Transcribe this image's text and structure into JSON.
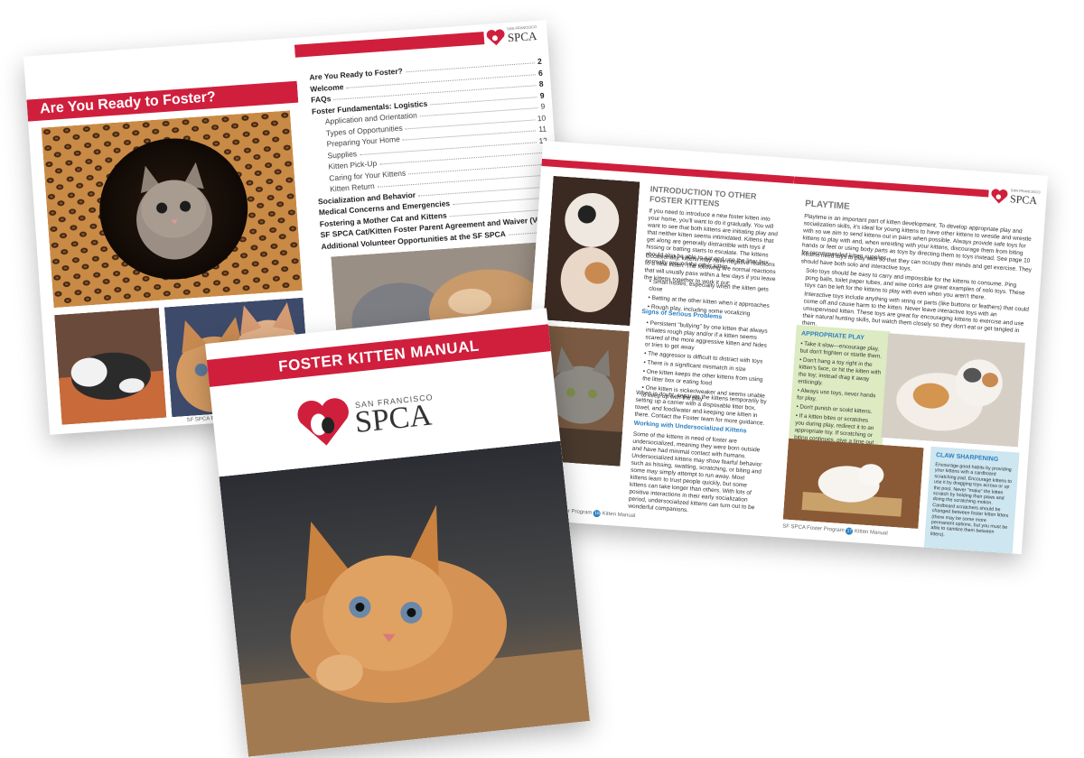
{
  "brand": {
    "small": "SAN FRANCISCO",
    "name": "SPCA",
    "accent": "#cf1f3d"
  },
  "back_spread": {
    "banner": "Are You Ready to Foster?",
    "footer": "SF SPCA Foster Program",
    "toc": [
      {
        "label": "Are You Ready to Foster?",
        "page": "2",
        "style": "b"
      },
      {
        "label": "Welcome",
        "page": "6",
        "style": "b"
      },
      {
        "label": "FAQs",
        "page": "8",
        "style": "b"
      },
      {
        "label": "Foster Fundamentals: Logistics",
        "page": "9",
        "style": "b"
      },
      {
        "label": "Application and Orientation",
        "page": "9",
        "style": "sub"
      },
      {
        "label": "Types of Opportunities",
        "page": "10",
        "style": "sub"
      },
      {
        "label": "Preparing Your Home",
        "page": "11",
        "style": "sub"
      },
      {
        "label": "Supplies",
        "page": "12",
        "style": "sub"
      },
      {
        "label": "Kitten Pick-Up",
        "page": "",
        "style": "sub"
      },
      {
        "label": "Caring for Your Kittens",
        "page": "",
        "style": "sub"
      },
      {
        "label": "Kitten Return",
        "page": "",
        "style": "sub"
      },
      {
        "label": "Socialization and Behavior",
        "page": "",
        "style": "b"
      },
      {
        "label": "Medical Concerns and Emergencies",
        "page": "",
        "style": "b"
      },
      {
        "label": "Fostering a Mother Cat and Kittens",
        "page": "",
        "style": "b"
      },
      {
        "label": "SF SPCA Cat/Kitten Foster Parent Agreement and Waiver (Volunteer Co",
        "page": "",
        "style": "b"
      },
      {
        "label": "Additional Volunteer Opportunities at the SF SPCA",
        "page": "",
        "style": "b"
      }
    ]
  },
  "middle_spread": {
    "heading": "INTRODUCTION TO OTHER FOSTER KITTENS",
    "intro": "If you need to introduce a new foster kitten into your home, you'll want to do it gradually. You will want to see that both kittens are initiating play and that neither kitten seems intimidated. Kittens that get along are generally distractible with toys if hissing or batting starts to escalate. The kittens should also be able to eat and use the litter box normally around the other kitten.",
    "para2": "Occasionally, kittens may have negative reactions to a new kitten. The following are normal reactions that will usually pass within a few days if you leave the kittens together to work it out:",
    "bullets1": [
      "Small hisses, especially when the kitten gets close",
      "Batting at the other kitten when it approaches",
      "Rough play, including some vocalizing"
    ],
    "signs_heading": "Signs of Serious Problems",
    "bullets2": [
      "Persistent \"bullying\" by one kitten that always initiates rough play and/or if a kitten seems scared of the more aggressive kitten and hides or tries to get away",
      "The aggressor is difficult to distract with toys",
      "There is a significant mismatch in size",
      "One kitten keeps the other kittens from using the litter box or eating food",
      "One kitten is sicker/weaker and seems unable to keep up with the play"
    ],
    "doubt": "When in doubt, separate the kittens temporarily by setting up a carrier with a disposable litter box, towel, and food/water and keeping one kitten in there. Contact the Foster team for more guidance.",
    "unsoc_heading": "Working with Undersocialized Kittens",
    "unsoc": "Some of the kittens in need of foster are undersocialized, meaning they were born outside and have had minimal contact with humans. Undersocialized kittens may show fearful behavior such as hissing, swatting, scratching, or biting and some may simply attempt to run away. Most kittens learn to trust people quickly, but some kittens can take longer than others. With lots of positive interactions in their early socialization period, undersocialized kittens can turn out to be wonderful companions.",
    "playtime_heading": "PLAYTIME",
    "playtime": "Playtime is an important part of kitten development. To develop appropriate play and socialization skills, it's ideal for young kittens to have other kittens to wrestle and wrestle with so we aim to send kittens out in pairs when possible. Always provide safe toys for kittens to play with and, when wrestling with your kittens, discourage them from biting hands or feet or using body parts as toys by directing them to toys instead. See page 10 for recommended kitten supplies.",
    "playtime2": "Kittens need toys to play with so that they can occupy their minds and get exercise. They should have both solo and interactive toys.",
    "solo": "Solo toys should be easy to carry and impossible for the kittens to consume. Ping pong balls, toilet paper tubes, and wine corks are great examples of solo toys. These toys can be left for the kittens to play with even when you aren't there.",
    "interactive": "Interactive toys include anything with string or parts (like buttons or feathers) that could come off and cause harm to the kitten. Never leave interactive toys with an unsupervised kitten. These toys are great for encouraging kittens to exercise and use their natural hunting skills, but watch them closely so they don't eat or get tangled in them.",
    "appropriate_heading": "APPROPRIATE PLAY",
    "appropriate": [
      "Take it slow—encourage play, but don't frighten or startle them.",
      "Don't hang a toy right in the kitten's face, or hit the kitten with the toy; instead drag it away enticingly.",
      "Always use toys, never hands for play.",
      "Don't punish or scold kittens.",
      "If a kitten bites or scratches you during play, redirect it to an appropriate toy. If scratching or biting continues, give a time out or end the visit."
    ],
    "claw_heading": "CLAW SHARPENING",
    "claw": "Encourage good habits by providing your kittens with a cardboard scratching pad. Encourage kittens to use it by dragging toys across or up the post. Never \"make\" the kitten scratch by holding their paws and doing the scratching motion. Cardboard scratchers should be changed between foster kitten litters (there may be some more permanent options, but you must be able to sanitize them between litters).",
    "footer_left": "SF SPCA Foster Program",
    "footer_left_num": "16",
    "footer_left_tail": "Kitten Manual",
    "footer_right": "SF SPCA Foster Program",
    "footer_right_num": "17",
    "footer_right_tail": "Kitten Manual"
  },
  "cover": {
    "title": "FOSTER KITTEN MANUAL"
  }
}
